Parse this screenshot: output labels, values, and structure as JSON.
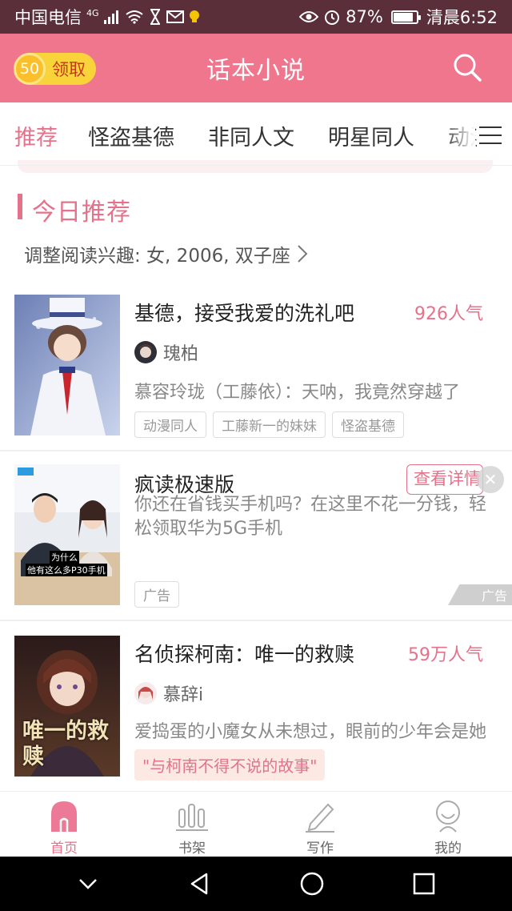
{
  "status_bar": {
    "carrier": "中国电信",
    "network": "4G",
    "battery_percent": "87%",
    "battery_level": 0.87,
    "time": "清晨6:52"
  },
  "header": {
    "title": "话本小说",
    "coins": "50",
    "claim_label": "领取"
  },
  "tabs": [
    {
      "label": "推荐",
      "active": true
    },
    {
      "label": "怪盗基德"
    },
    {
      "label": "非同人文"
    },
    {
      "label": "明星同人"
    },
    {
      "label": "动漫"
    }
  ],
  "section": {
    "title": "今日推荐",
    "interest_text": "调整阅读兴趣: 女, 2006, 双子座"
  },
  "books": [
    {
      "title": "基德，接受我爱的洗礼吧",
      "popularity": "926人气",
      "author": "瑰柏",
      "description": "慕容玲珑（工藤依）：天呐，我竟然穿越了",
      "tags": [
        "动漫同人",
        "工藤新一的妹妹",
        "怪盗基德"
      ]
    },
    {
      "title": "名侦探柯南：唯一的救赎",
      "popularity": "59万人气",
      "author": "慕辞i",
      "description": "爱捣蛋的小魔女从未想过，眼前的少年会是她",
      "tag": "\"与柯南不得不说的故事\"",
      "cover_text": "唯一的救赎"
    }
  ],
  "ad": {
    "title": "疯读极速版",
    "description": "你还在省钱买手机吗？在这里不花一分钱，轻松领取华为5G手机",
    "detail_button": "查看详情",
    "tag": "广告",
    "badge": "广告",
    "image_caption_1": "为什么",
    "image_caption_2": "他有这么多P30手机"
  },
  "bottom_nav": [
    {
      "label": "首页",
      "icon": "home-icon",
      "active": true
    },
    {
      "label": "书架",
      "icon": "bookshelf-icon"
    },
    {
      "label": "写作",
      "icon": "pen-icon"
    },
    {
      "label": "我的",
      "icon": "profile-icon"
    }
  ],
  "colors": {
    "accent": "#e4728a",
    "header_bg": "#f0768e",
    "status_bar_bg": "#5a2f3a"
  }
}
